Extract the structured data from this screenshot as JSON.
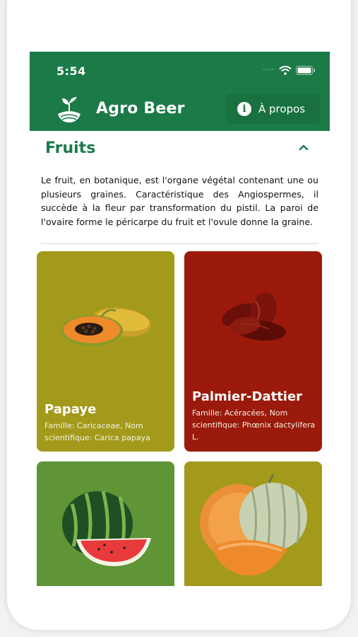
{
  "status": {
    "time": "5:54"
  },
  "header": {
    "title": "Agro Beer",
    "about_label": "À propos"
  },
  "section": {
    "title": "Fruits",
    "description": "Le fruit, en botanique, est l'organe végétal contenant une ou plusieurs graines. Caractéristique des Angiospermes, il succède à la fleur par transformation du pistil. La paroi de l'ovaire forme le péricarpe du fruit et l'ovule donne la graine."
  },
  "cards": [
    {
      "name": "Papaye",
      "info": "Famille: Caricaceae, Nom scientifique: Carica papaya",
      "color": "#a39a1b"
    },
    {
      "name": "Palmier-Dattier",
      "info": "Famille: Acéracées, Nom scientifique: Phœnix dactylifera L.",
      "color": "#9b1a0b"
    },
    {
      "name": "",
      "info": "",
      "color": "#5f9437"
    },
    {
      "name": "",
      "info": "",
      "color": "#a39a1b"
    }
  ],
  "colors": {
    "primary": "#1b7a48",
    "olive": "#a39a1b",
    "crimson": "#9b1a0b",
    "green": "#5f9437"
  },
  "icons": [
    "wifi-icon",
    "battery-icon",
    "agro-logo-icon",
    "info-icon",
    "chevron-up-icon"
  ]
}
